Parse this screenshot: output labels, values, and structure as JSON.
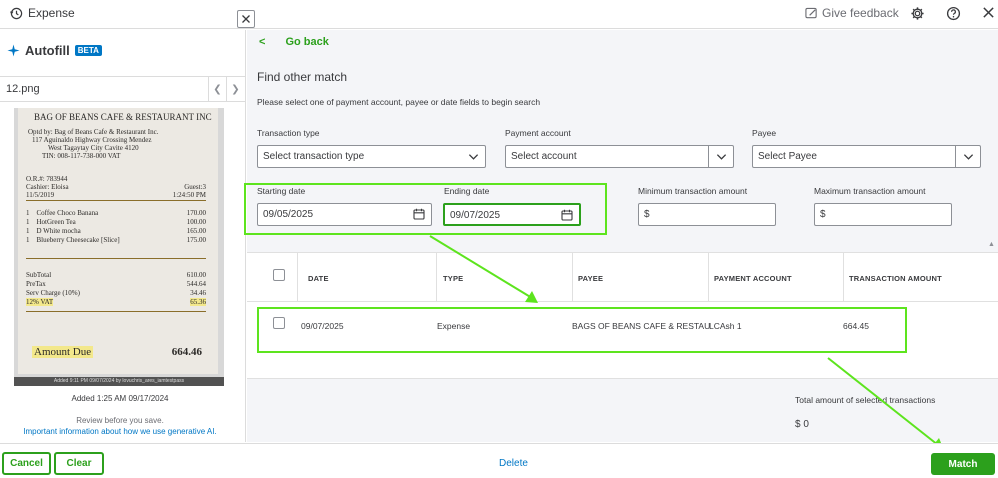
{
  "topbar": {
    "title": "Expense",
    "feedback_label": "Give feedback"
  },
  "autofill": {
    "title": "Autofill",
    "badge": "BETA",
    "file_name": "12.png",
    "caption": "Added 9:11 PM 09/07/2024 by lovuchris_ares_iamtestpass",
    "added": "Added 1:25 AM 09/17/2024",
    "review": "Review before you save.",
    "important_link": "Important information about how we use generative AI."
  },
  "receipt": {
    "header": "BAG OF BEANS CAFE & RESTAURANT INC",
    "line1": "Optd by: Bag of Beans Cafe & Restaurant Inc.",
    "line2": "117 Aguinaldo Highway Crossing Mendez",
    "line3": "West Tagaytay City Cavite 4120",
    "line4": "TIN: 008-117-738-000 VAT",
    "or_no": "O.R.#: 783944",
    "cashier": "Cashier: Eloisa",
    "guest": "Guest:3",
    "date": "11/5/2019",
    "time": "1:24:50 PM",
    "items": [
      {
        "qty": "1",
        "name": "Coffee Choco Banana",
        "price": "170.00"
      },
      {
        "qty": "1",
        "name": "HotGreen Tea",
        "price": "100.00"
      },
      {
        "qty": "1",
        "name": "D White mocha",
        "price": "165.00"
      },
      {
        "qty": "1",
        "name": "Blueberry Cheesecake [Slice]",
        "price": "175.00"
      }
    ],
    "subtotal_label": "SubTotal",
    "subtotal": "610.00",
    "pretax_label": "PreTax",
    "pretax": "544.64",
    "serv_label": "Serv Charge (10%)",
    "serv": "34.46",
    "vat_label": "12% VAT",
    "vat": "65.36",
    "due_label": "Amount Due",
    "due": "664.46"
  },
  "main": {
    "go_back": "Go back",
    "heading": "Find other match",
    "instructions": "Please select one of payment account, payee or date fields to begin search",
    "transaction_type": {
      "label": "Transaction type",
      "placeholder": "Select transaction type"
    },
    "payment_account": {
      "label": "Payment account",
      "placeholder": "Select account"
    },
    "payee": {
      "label": "Payee",
      "placeholder": "Select Payee"
    },
    "starting_date": {
      "label": "Starting date",
      "value": "09/05/2025"
    },
    "ending_date": {
      "label": "Ending date",
      "value": "09/07/2025"
    },
    "min_amount": {
      "label": "Minimum transaction amount",
      "prefix": "$"
    },
    "max_amount": {
      "label": "Maximum transaction amount",
      "prefix": "$"
    }
  },
  "table": {
    "columns": [
      "DATE",
      "TYPE",
      "PAYEE",
      "PAYMENT ACCOUNT",
      "TRANSACTION AMOUNT"
    ],
    "rows": [
      {
        "date": "09/07/2025",
        "type": "Expense",
        "payee": "BAGS OF BEANS CAFE & RESTAU",
        "account": "LCAsh 1",
        "amount": "664.45"
      }
    ]
  },
  "totals": {
    "label": "Total amount of selected transactions",
    "value": "$ 0"
  },
  "footer": {
    "cancel": "Cancel",
    "clear": "Clear",
    "delete": "Delete",
    "match": "Match"
  },
  "colors": {
    "brand_green": "#2ca01c",
    "link_blue": "#0077c5",
    "annotation_green": "#5de41e"
  }
}
